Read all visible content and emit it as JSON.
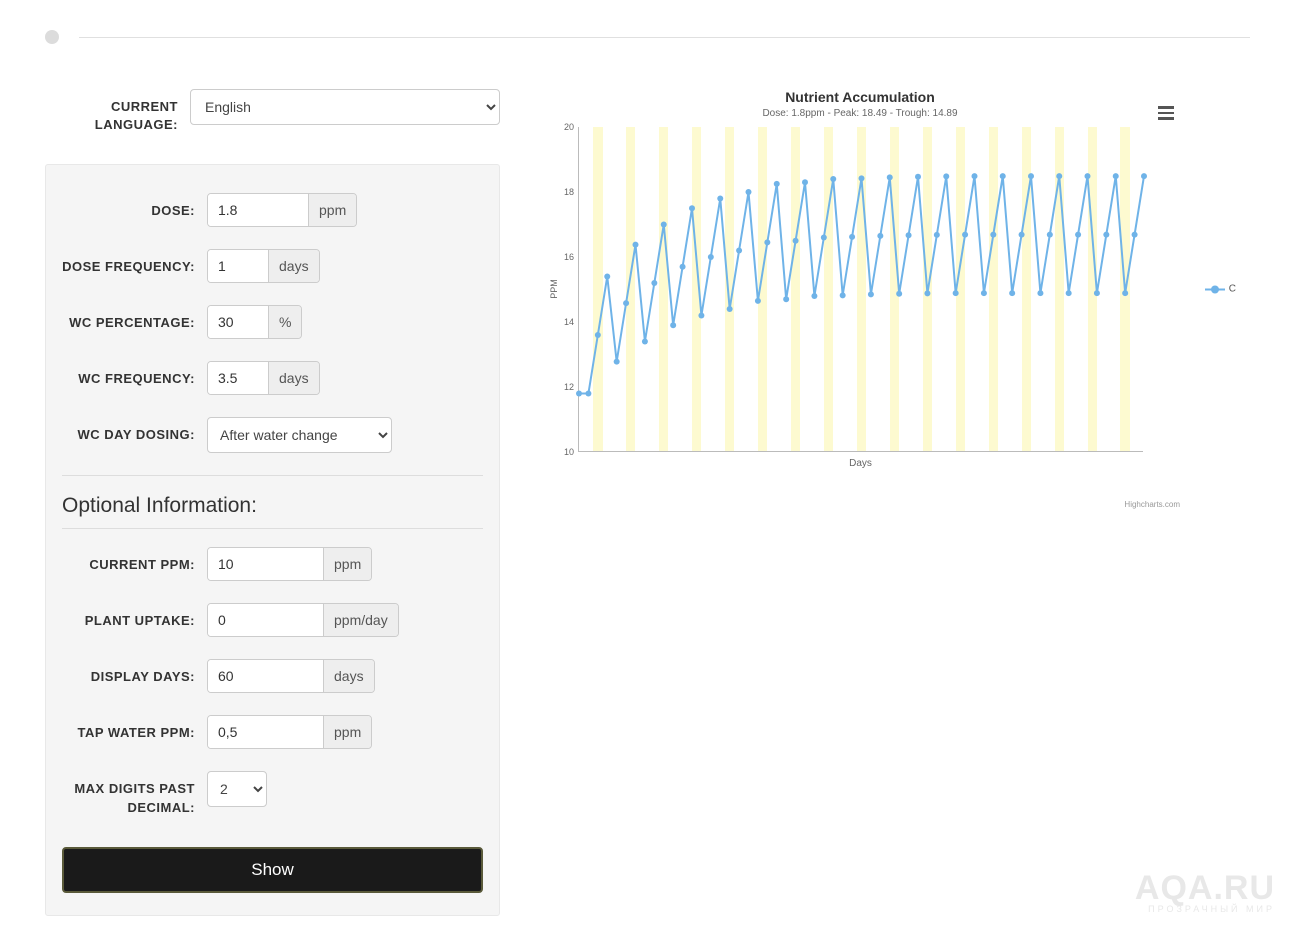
{
  "lang": {
    "label": "CURRENT LANGUAGE:",
    "value": "English"
  },
  "form": {
    "dose": {
      "label": "DOSE:",
      "value": "1.8",
      "unit": "ppm"
    },
    "dose_freq": {
      "label": "DOSE FREQUENCY:",
      "value": "1",
      "unit": "days"
    },
    "wc_pct": {
      "label": "WC PERCENTAGE:",
      "value": "30",
      "unit": "%"
    },
    "wc_freq": {
      "label": "WC FREQUENCY:",
      "value": "3.5",
      "unit": "days"
    },
    "wc_day": {
      "label": "WC DAY DOSING:",
      "value": "After water change"
    }
  },
  "optional_title": "Optional Information:",
  "optional": {
    "cur_ppm": {
      "label": "CURRENT PPM:",
      "value": "10",
      "unit": "ppm"
    },
    "uptake": {
      "label": "PLANT UPTAKE:",
      "value": "0",
      "unit": "ppm/day"
    },
    "disp_days": {
      "label": "DISPLAY DAYS:",
      "value": "60",
      "unit": "days"
    },
    "tap": {
      "label": "TAP WATER PPM:",
      "value": "0,5",
      "unit": "ppm"
    },
    "digits": {
      "label": "MAX DIGITS PAST DECIMAL:",
      "value": "2"
    }
  },
  "show_btn": "Show",
  "chart_data": {
    "type": "line",
    "title": "Nutrient Accumulation",
    "subtitle": "Dose: 1.8ppm - Peak: 18.49 - Trough: 14.89",
    "xlabel": "Days",
    "ylabel": "PPM",
    "ylim": [
      10,
      20
    ],
    "y_ticks": [
      10,
      12,
      14,
      16,
      18,
      20
    ],
    "legend": "C",
    "credit": "Highcharts.com",
    "series": [
      {
        "name": "C",
        "values": [
          11.8,
          11.8,
          13.6,
          15.4,
          12.78,
          14.58,
          16.38,
          13.4,
          15.2,
          17.0,
          13.9,
          15.7,
          17.5,
          14.2,
          16.0,
          17.8,
          14.4,
          16.2,
          18.0,
          14.65,
          16.45,
          18.25,
          14.7,
          16.5,
          18.3,
          14.8,
          16.6,
          18.4,
          14.82,
          16.62,
          18.42,
          14.85,
          16.65,
          18.45,
          14.87,
          16.67,
          18.47,
          14.88,
          16.68,
          18.48,
          14.89,
          16.69,
          18.49,
          14.89,
          16.69,
          18.49,
          14.89,
          16.69,
          18.49,
          14.89,
          16.69,
          18.49,
          14.89,
          16.69,
          18.49,
          14.89,
          16.69,
          18.49,
          14.89,
          16.69,
          18.49
        ]
      }
    ],
    "band_start": 1.5,
    "band_period": 3.5,
    "band_width": 1,
    "x_count": 60
  },
  "watermark": {
    "top": "AQA.RU",
    "bot": "ПРОЗРАЧНЫЙ МИР"
  }
}
